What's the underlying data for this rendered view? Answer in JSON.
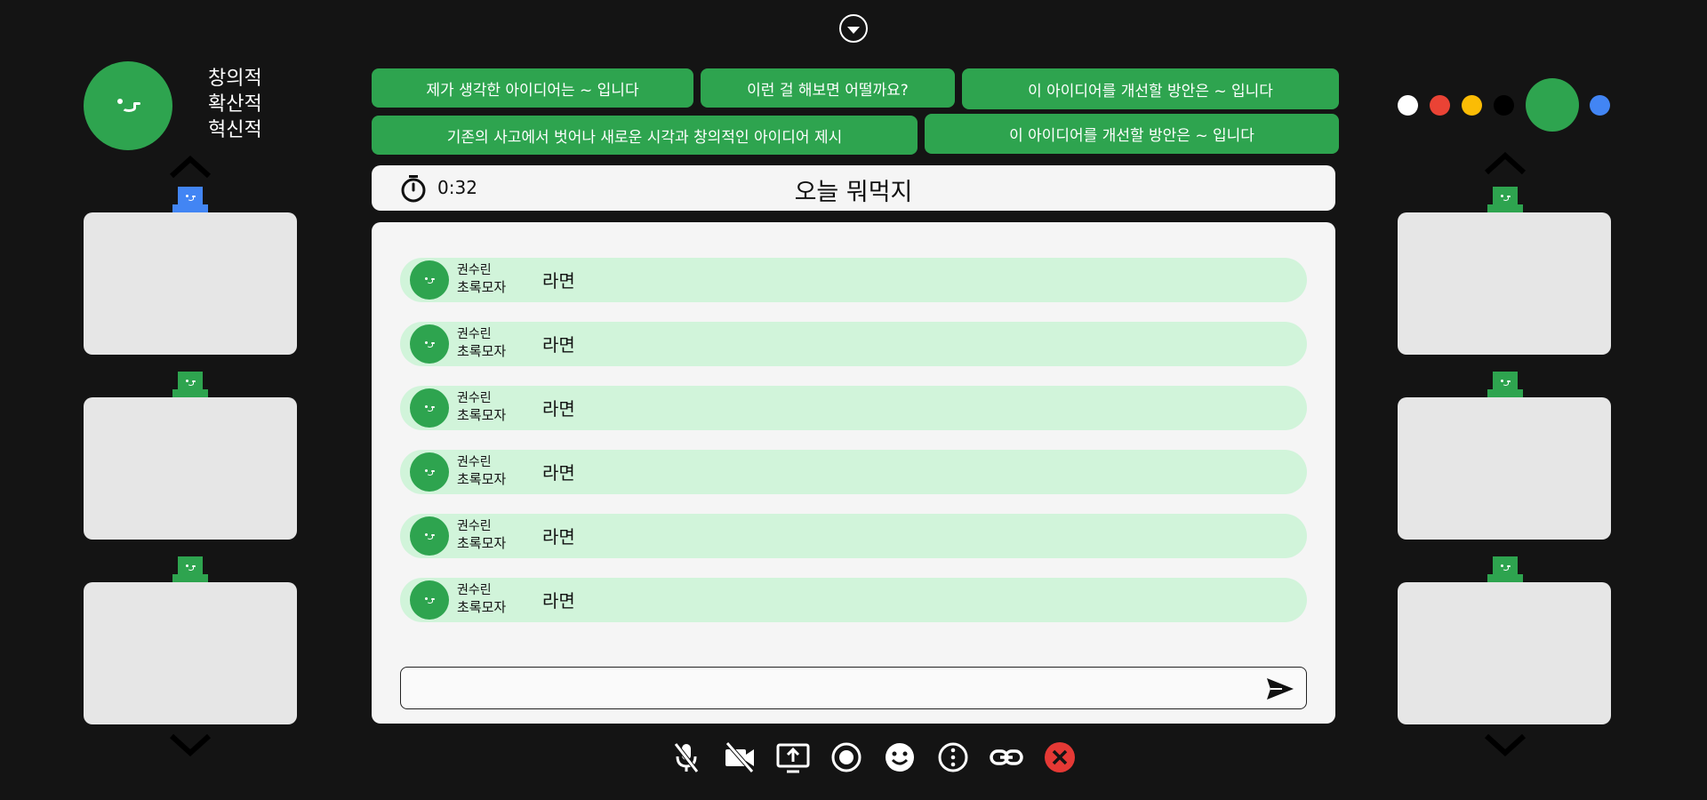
{
  "logo": {
    "lines": [
      "창의적",
      "확산적",
      "혁신적"
    ]
  },
  "prompts": [
    "제가 생각한 아이디어는 ~ 입니다",
    "이런 걸 해보면 어떨까요?",
    "이 아이디어를 개선할 방안은 ~ 입니다",
    "기존의 사고에서 벗어나 새로운 시각과 창의적인 아이디어 제시",
    "이 아이디어를 개선할 방안은 ~ 입니다"
  ],
  "timer": {
    "value": "0:32"
  },
  "room": {
    "title": "오늘 뭐먹지"
  },
  "messages": [
    {
      "name": "권수린",
      "nick": "초록모자",
      "text": "라면"
    },
    {
      "name": "권수린",
      "nick": "초록모자",
      "text": "라면"
    },
    {
      "name": "권수린",
      "nick": "초록모자",
      "text": "라면"
    },
    {
      "name": "권수린",
      "nick": "초록모자",
      "text": "라면"
    },
    {
      "name": "권수린",
      "nick": "초록모자",
      "text": "라면"
    },
    {
      "name": "권수린",
      "nick": "초록모자",
      "text": "라면"
    }
  ],
  "chat_input": {
    "value": "",
    "placeholder": ""
  },
  "palette": {
    "colors": [
      "#ffffff",
      "#ea4335",
      "#fbbc05",
      "#000000",
      "#2ea44f",
      "#4285f4"
    ],
    "selected": "#2ea44f"
  },
  "participants_left": [
    {
      "hat_color": "#4285f4"
    },
    {
      "hat_color": "#2ea44f"
    },
    {
      "hat_color": "#2ea44f"
    }
  ],
  "participants_right": [
    {
      "hat_color": "#2ea44f"
    },
    {
      "hat_color": "#2ea44f"
    },
    {
      "hat_color": "#2ea44f"
    }
  ],
  "toolbar": {
    "icons": [
      "mic-off-icon",
      "video-off-icon",
      "screen-share-icon",
      "record-icon",
      "emoji-icon",
      "more-options-icon",
      "link-icon",
      "leave-icon"
    ]
  },
  "colors": {
    "accent": "#2ea44f",
    "accent_light": "#d1f4da",
    "danger": "#e53935",
    "background": "#141414"
  }
}
